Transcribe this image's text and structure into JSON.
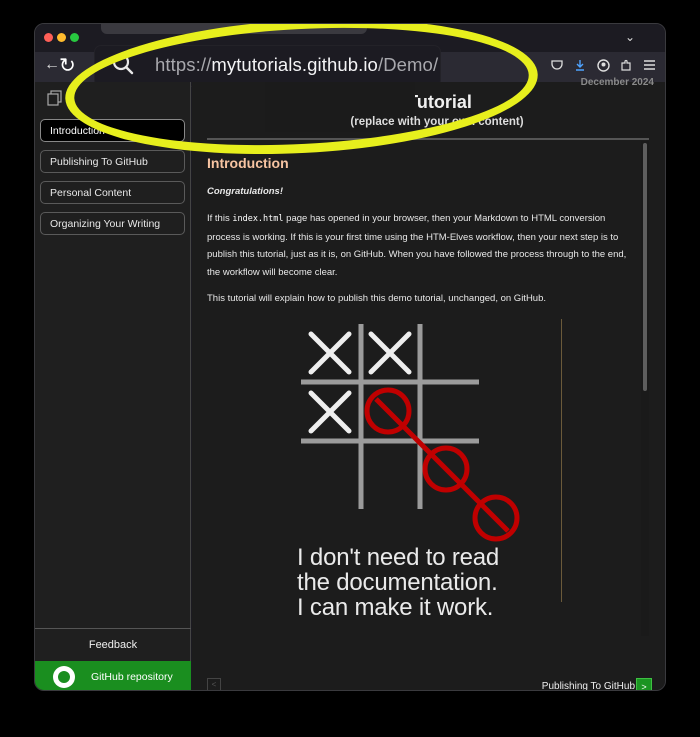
{
  "browser": {
    "url_prefix": "https://",
    "url_host": "mytutorials.github.io",
    "url_path": "/Demo/",
    "toolbar_icons": [
      "pocket-icon",
      "download-icon",
      "account-icon",
      "extensions-icon",
      "menu-icon"
    ]
  },
  "sidebar": {
    "items": [
      {
        "label": "Introduction"
      },
      {
        "label": "Publishing To GitHub"
      },
      {
        "label": "Personal Content"
      },
      {
        "label": "Organizing Your Writing"
      }
    ],
    "feedback": "Feedback",
    "github_button": "GitHub repository"
  },
  "header": {
    "date": "December 2024",
    "title": "Tutorial",
    "subtitle": "(replace with your own content)"
  },
  "article": {
    "heading": "Introduction",
    "congrats": "Congratulations!",
    "p1_pre": "If this ",
    "p1_code": "index.html",
    "p1_post": " page has opened in your browser, then your Markdown to HTML conversion process is working. If this is your first time using the HTM-Elves workflow, then your next step is to publish this tutorial, just as it is, on GitHub. When you have followed the process through to the end, the workflow will become clear.",
    "p2": "This tutorial will explain how to publish this demo tutorial, unchanged, on GitHub.",
    "caption": "I don't need to read\nthe documentation.\nI can make it work."
  },
  "pager": {
    "prev": "<",
    "next_label": "Publishing To GitHub",
    "next": ">"
  },
  "colors": {
    "accent_heading": "#f7c4a2",
    "highlight_ring": "#e7ef1d",
    "github_green": "#1a8e1f",
    "figure_red": "#c00000"
  }
}
